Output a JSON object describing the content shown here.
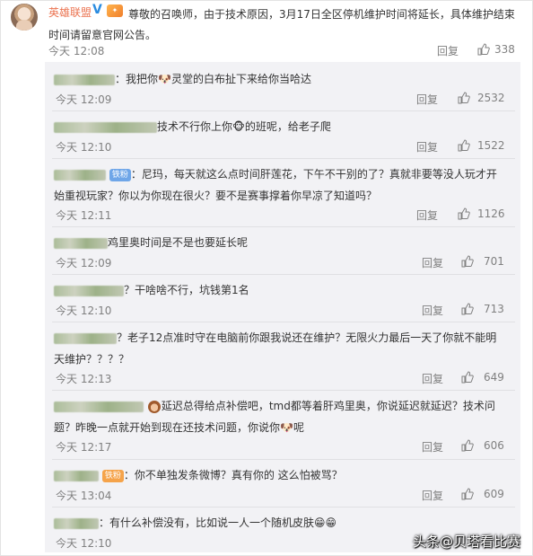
{
  "post": {
    "user": "英雄联盟",
    "vip_badge": "V",
    "text": "尊敬的召唤师，由于技术原因，3月17日全区停机维护时间将延长，具体维护结束时间请留意官网公告。",
    "time": "今天 12:08",
    "reply_label": "回复",
    "likes": "338"
  },
  "comments": [
    {
      "text": "我把你🐶灵堂的白布扯下来给你当哈达",
      "time": "今天 12:09",
      "reply_label": "回复",
      "likes": "2532"
    },
    {
      "text": "技术不行你上你🐵的班呢，给老子爬",
      "time": "今天 12:10",
      "reply_label": "回复",
      "likes": "1522"
    },
    {
      "badge": "铁粉",
      "text": "尼玛，每天就这么点时间肝莲花，下午不干别的了？真就非要等没人玩才开始重视玩家？你以为你现在很火？要不是赛事撑着你早凉了知道吗？",
      "time": "今天 12:11",
      "reply_label": "回复",
      "likes": "1126"
    },
    {
      "text": "鸡里奥时间是不是也要延长呢",
      "time": "今天 12:09",
      "reply_label": "回复",
      "likes": "701"
    },
    {
      "text": "？干啥啥不行，坑钱第1名",
      "time": "今天 12:10",
      "reply_label": "回复",
      "likes": "713"
    },
    {
      "text": "？老子12点准时守在电脑前你跟我说还在维护？无限火力最后一天了你就不能明天维护？？？？",
      "time": "今天 12:13",
      "reply_label": "回复",
      "likes": "649"
    },
    {
      "text": "延迟总得给点补偿吧，tmd都等着肝鸡里奥，你说延迟就延迟？技术问题？昨晚一点就开始到现在还技术问题，你说你🐶呢",
      "time": "今天 12:17",
      "reply_label": "回复",
      "likes": "606"
    },
    {
      "badge": "铁粉",
      "text": "你不单独发条微博？真有你的 这么怕被骂？",
      "time": "今天 13:04",
      "reply_label": "回复",
      "likes": "609"
    },
    {
      "text": "有什么补偿没有，比如说一人一个随机皮肤😁😁",
      "time": "今天 12:10"
    }
  ],
  "watermark": "头条@贝塔看比赛",
  "colors": {
    "username": "#eb7350",
    "meta": "#808080",
    "reply_bg": "#f2f2f5",
    "verified": "#2b8ce0"
  },
  "icons": [
    "like-icon",
    "v-verified-icon",
    "vip-icon",
    "emoji-dog-icon",
    "emoji-monkey-icon",
    "emoji-grin-icon"
  ]
}
